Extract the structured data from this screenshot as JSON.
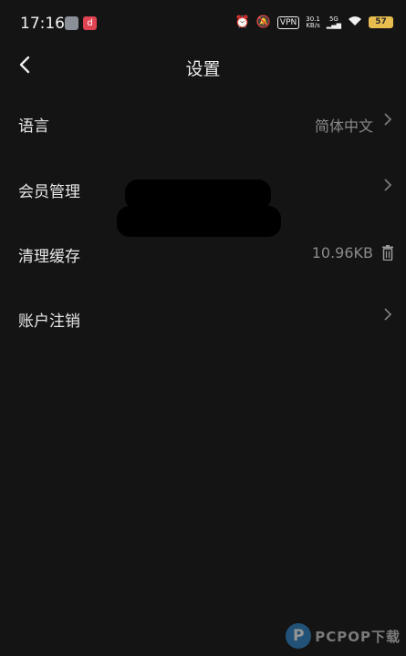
{
  "status_bar": {
    "time": "17:16",
    "app2_icon": "d",
    "vpn_label": "VPN",
    "speed_value": "30.1",
    "speed_unit": "KB/s",
    "network": "5G",
    "battery": "57"
  },
  "header": {
    "title": "设置"
  },
  "settings": {
    "language": {
      "label": "语言",
      "value": "简体中文"
    },
    "membership": {
      "label": "会员管理"
    },
    "cache": {
      "label": "清理缓存",
      "value": "10.96KB"
    },
    "account_cancel": {
      "label": "账户注销"
    }
  },
  "watermark": {
    "logo_letter": "P",
    "text": "PCPOP下载"
  },
  "colors": {
    "background": "#141414",
    "text": "#e8e8e8",
    "secondary_text": "#8a8a8a",
    "battery": "#e7bd4f",
    "watermark_blue": "#2f86c9"
  }
}
